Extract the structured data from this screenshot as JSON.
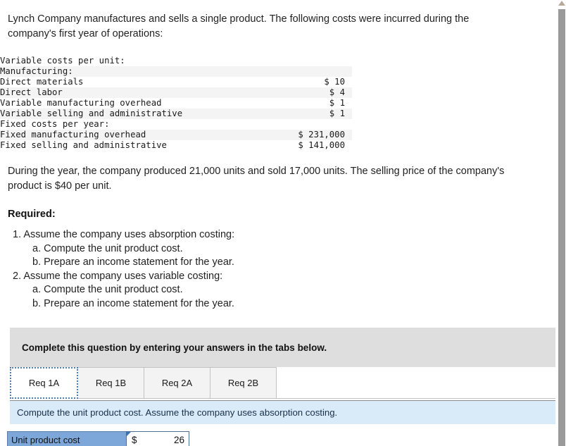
{
  "problem": {
    "intro": "Lynch Company manufactures and sells a single product. The following costs were incurred during the company's first year of operations:",
    "during": "During the year, the company produced 21,000 units and sold 17,000 units. The selling price of the company's product is $40 per unit.",
    "required_heading": "Required:"
  },
  "cost_table": {
    "rows": [
      {
        "label": "Variable costs per unit:",
        "indent": 1,
        "amount": "",
        "shaded": false
      },
      {
        "label": "Manufacturing:",
        "indent": 2,
        "amount": "",
        "shaded": true
      },
      {
        "label": "Direct materials",
        "indent": 3,
        "amount": "$ 10",
        "shaded": false
      },
      {
        "label": "Direct labor",
        "indent": 3,
        "amount": "$ 4",
        "shaded": true
      },
      {
        "label": "Variable manufacturing overhead",
        "indent": 3,
        "amount": "$ 1",
        "shaded": false
      },
      {
        "label": "Variable selling and administrative",
        "indent": 2,
        "amount": "$ 1",
        "shaded": true
      },
      {
        "label": "Fixed costs per year:",
        "indent": 1,
        "amount": "",
        "shaded": false
      },
      {
        "label": "Fixed manufacturing overhead",
        "indent": 2,
        "amount": "$ 231,000",
        "shaded": true
      },
      {
        "label": "Fixed selling and administrative",
        "indent": 2,
        "amount": "$ 141,000",
        "shaded": false
      }
    ]
  },
  "requirements": [
    {
      "text": "1. Assume the company uses absorption costing:",
      "level": 1
    },
    {
      "text": "a. Compute the unit product cost.",
      "level": 2
    },
    {
      "text": "b. Prepare an income statement for the year.",
      "level": 2
    },
    {
      "text": "2. Assume the company uses variable costing:",
      "level": 1
    },
    {
      "text": "a. Compute the unit product cost.",
      "level": 2
    },
    {
      "text": "b. Prepare an income statement for the year.",
      "level": 2
    }
  ],
  "instruction_bar": {
    "text": "Complete this question by entering your answers in the tabs below."
  },
  "tabs": [
    {
      "label": "Req 1A",
      "active": true
    },
    {
      "label": "Req 1B",
      "active": false
    },
    {
      "label": "Req 2A",
      "active": false
    },
    {
      "label": "Req 2B",
      "active": false
    }
  ],
  "sub_banner": {
    "text": "Compute the unit product cost. Assume the company uses absorption costing."
  },
  "answer_row": {
    "label": "Unit product cost",
    "currency": "$",
    "value": "26"
  },
  "colors": {
    "instruction_bar_bg": "#dedede",
    "sub_banner_bg": "#d9eaf8",
    "answer_label_bg": "#7da7d9",
    "tab_inactive_bg": "#f3f3f3",
    "tab_active_border": "#4a7ebb",
    "table_shaded_row": "#f4f4f4"
  }
}
